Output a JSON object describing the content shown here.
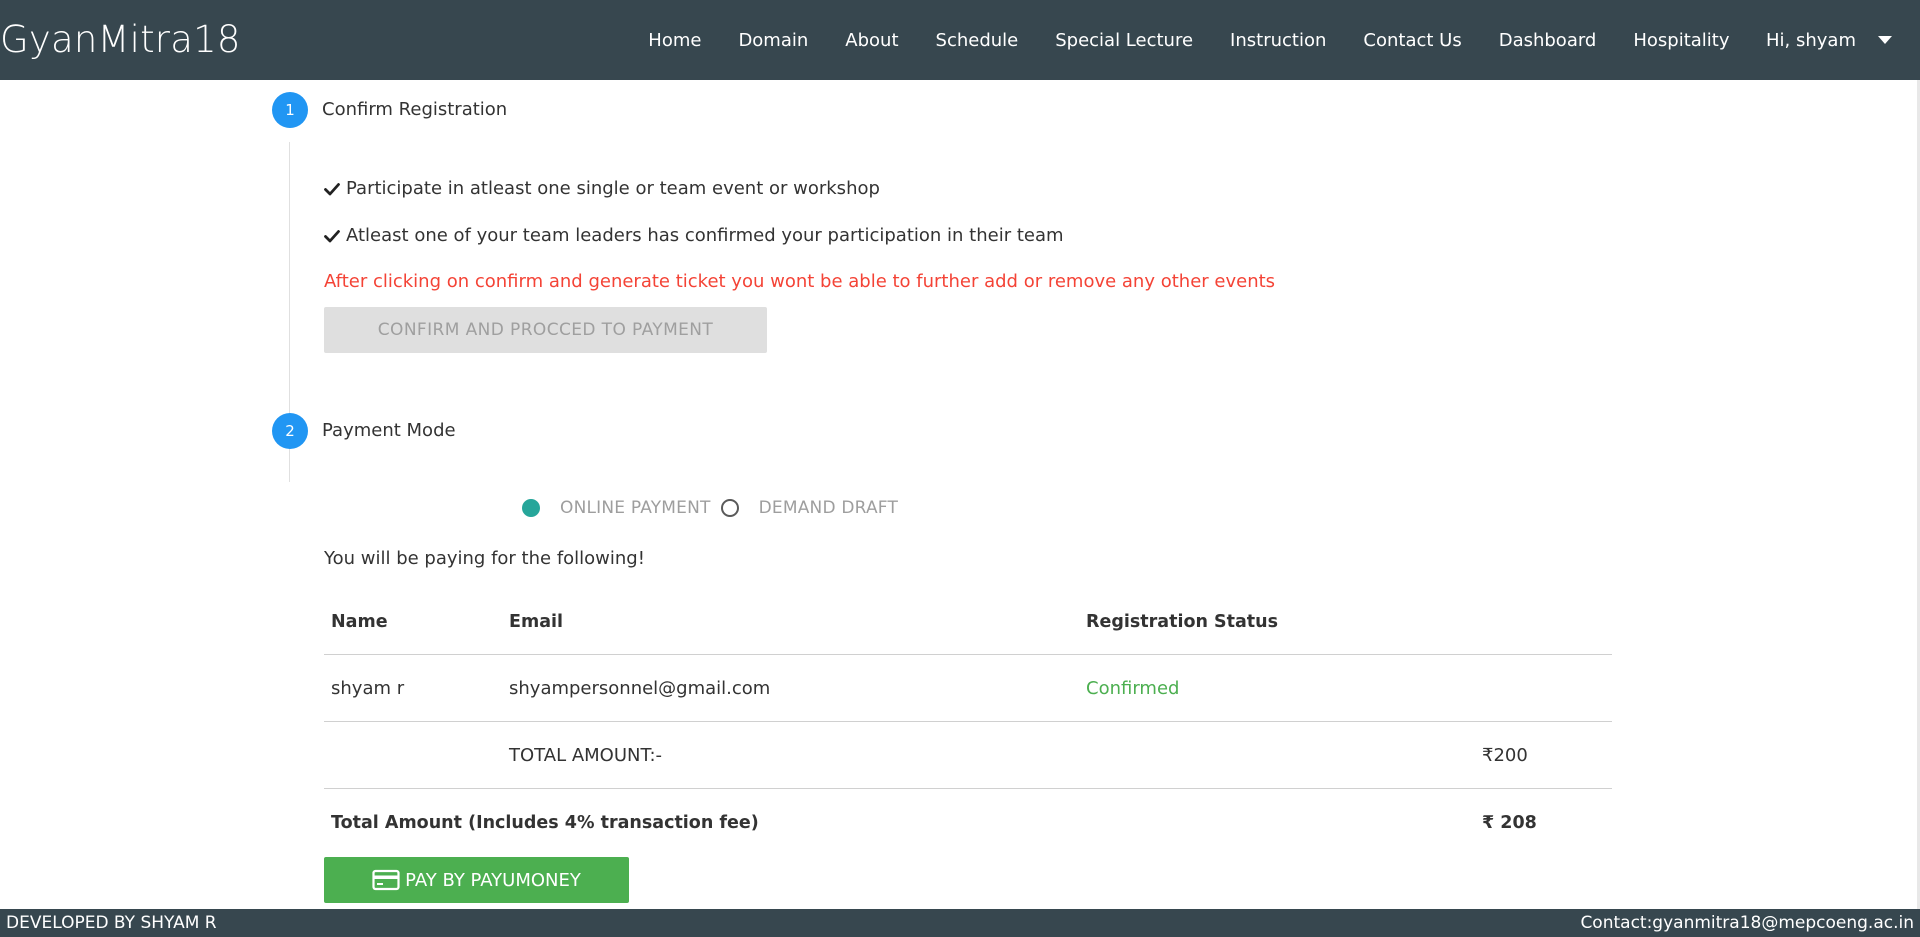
{
  "brand": "GyanMitra18",
  "nav": {
    "items": [
      "Home",
      "Domain",
      "About",
      "Schedule",
      "Special Lecture",
      "Instruction",
      "Contact Us",
      "Dashboard",
      "Hospitality"
    ],
    "user_label": "Hi, shyam"
  },
  "step1": {
    "number": "1",
    "title": "Confirm Registration",
    "checks": [
      "Participate in atleast one single or team event or workshop",
      "Atleast one of your team leaders has confirmed your participation in their team"
    ],
    "warning": "After clicking on confirm and generate ticket you wont be able to further add or remove any other events",
    "confirm_button": "CONFIRM AND PROCCED TO PAYMENT"
  },
  "step2": {
    "number": "2",
    "title": "Payment Mode",
    "payment_options": [
      {
        "label": "ONLINE PAYMENT",
        "selected": true
      },
      {
        "label": "DEMAND DRAFT",
        "selected": false
      }
    ],
    "paying_for_text": "You will be paying for the following!"
  },
  "table": {
    "headers": {
      "name": "Name",
      "email": "Email",
      "status": "Registration Status"
    },
    "rows": [
      {
        "name": "shyam r",
        "email": "shyampersonnel@gmail.com",
        "status": "Confirmed"
      }
    ],
    "total_label": "TOTAL AMOUNT:-",
    "total_value": "₹200",
    "grand_total_label": "Total Amount (Includes 4% transaction fee)",
    "grand_total_value": "₹ 208"
  },
  "pay_button": "PAY BY PAYUMONEY",
  "footer": {
    "left": "DEVELOPED BY SHYAM R",
    "right": "Contact:gyanmitra18@mepcoeng.ac.in"
  },
  "colors": {
    "navbar": "#37474f",
    "step_circle": "#2196f3",
    "warning": "#f44336",
    "radio_checked": "#26a69a",
    "confirmed": "#4caf50",
    "pay_button": "#4caf50"
  },
  "icons": {
    "check": "check-icon",
    "card": "credit-card-icon",
    "dropdown": "chevron-down-icon"
  }
}
